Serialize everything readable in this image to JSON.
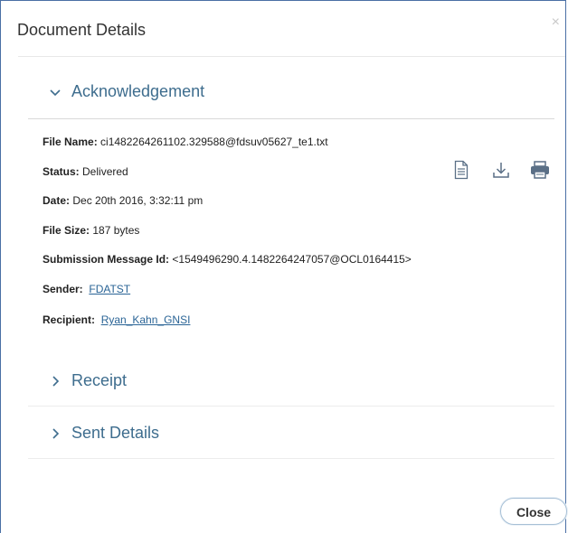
{
  "dialog": {
    "title": "Document Details",
    "close_glyph": "×",
    "close_button": "Close"
  },
  "sections": {
    "acknowledgement": {
      "label": "Acknowledgement",
      "expanded": true
    },
    "receipt": {
      "label": "Receipt",
      "expanded": false
    },
    "sent_details": {
      "label": "Sent Details",
      "expanded": false
    }
  },
  "details": {
    "file_name": {
      "label": "File Name:",
      "value": "ci1482264261102.329588@fdsuv05627_te1.txt"
    },
    "status": {
      "label": "Status:",
      "value": "Delivered"
    },
    "date": {
      "label": "Date:",
      "value": "Dec 20th 2016, 3:32:11 pm"
    },
    "file_size": {
      "label": "File Size:",
      "value": "187 bytes"
    },
    "submission_message_id": {
      "label": "Submission Message Id:",
      "value": "<1549496290.4.1482264247057@OCL0164415>"
    },
    "sender": {
      "label": "Sender:",
      "value": "FDATST"
    },
    "recipient": {
      "label": "Recipient:",
      "value": "Ryan_Kahn_GNSI"
    }
  },
  "actions": [
    {
      "name": "view-document-icon"
    },
    {
      "name": "download-icon"
    },
    {
      "name": "print-icon"
    }
  ],
  "colors": {
    "accent": "#3e6d8e",
    "link": "#2a6496",
    "border": "#4a6fa5"
  }
}
